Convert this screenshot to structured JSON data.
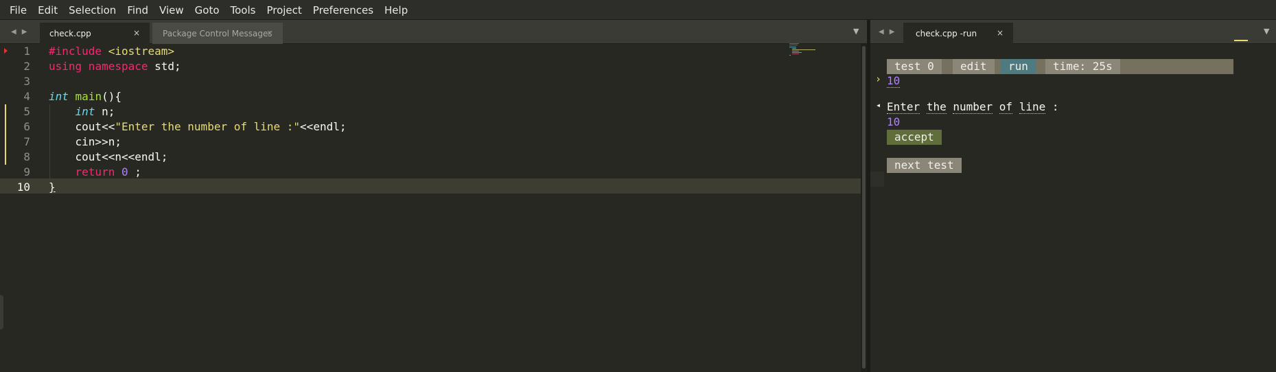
{
  "menu": [
    "File",
    "Edit",
    "Selection",
    "Find",
    "View",
    "Goto",
    "Tools",
    "Project",
    "Preferences",
    "Help"
  ],
  "tabs_left": [
    {
      "label": "check.cpp",
      "close": "×",
      "active": true
    },
    {
      "label": "Package Control Messages",
      "close": "×",
      "active": false
    }
  ],
  "tabs_right": [
    {
      "label": "check.cpp -run",
      "close": "×",
      "active": true
    }
  ],
  "nav_arrows": {
    "left": "◀",
    "right": "▶"
  },
  "dropdown_arrow": "▼",
  "editor": {
    "line_numbers": [
      "1",
      "2",
      "3",
      "4",
      "5",
      "6",
      "7",
      "8",
      "9",
      "10"
    ],
    "current_line": 10,
    "modified_lines": [
      5,
      6,
      7,
      8
    ],
    "code": {
      "l1": {
        "pre": "#include",
        "str": " <iostream>"
      },
      "l2": {
        "kw1": "using",
        "kw2": " namespace",
        "rest": " std;"
      },
      "l4": {
        "type": "int",
        "fn": " main",
        "rest": "(){"
      },
      "l5": {
        "indent": "    ",
        "type": "int",
        "rest": " n;"
      },
      "l6": {
        "indent": "    ",
        "a": "cout<<",
        "str": "\"Enter the number of line :\"",
        "b": "<<endl;"
      },
      "l7": {
        "text": "    cin>>n;"
      },
      "l8": {
        "text": "    cout<<n<<endl;"
      },
      "l9": {
        "indent": "    ",
        "kw": "return",
        "sp": " ",
        "num": "0",
        "rest": " ;"
      },
      "l10": {
        "text": "}"
      }
    }
  },
  "run_panel": {
    "buttons": [
      {
        "label": "test 0",
        "color": "#75715e"
      },
      {
        "label": "edit",
        "color": "#75715e"
      },
      {
        "label": "run",
        "color": "#4f7b80"
      },
      {
        "label": "time: 25s",
        "color": "#75715e"
      }
    ],
    "input_marker": "›",
    "input_value": "10",
    "output_marker": "◂",
    "output_text": "Enter the number of line :",
    "output_words": [
      "Enter",
      "the",
      "number",
      "of",
      "line",
      ":"
    ],
    "output_value": "10",
    "accept_label": "accept",
    "next_test_label": "next test",
    "accent_colors": {
      "accept": "#5f6e3b",
      "number": "#ae81ff",
      "marker": "#e6db74"
    }
  }
}
